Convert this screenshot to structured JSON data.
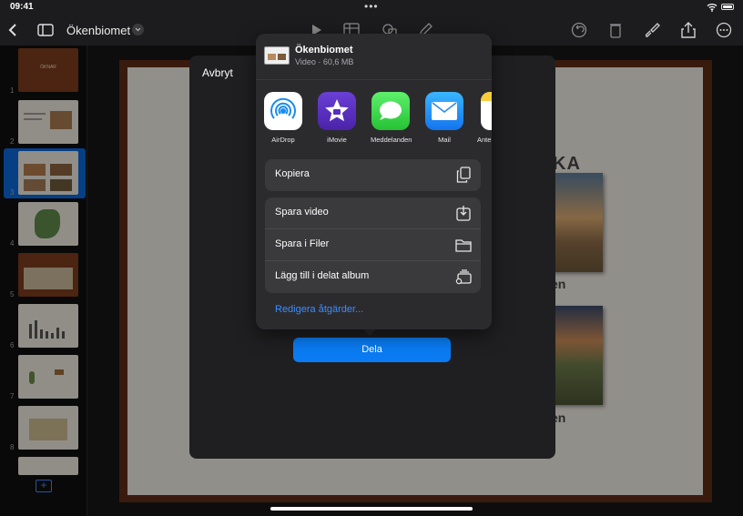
{
  "status_bar": {
    "time": "09:41",
    "dots": "•••"
  },
  "toolbar": {
    "document_title": "Ökenbiomet",
    "icons": [
      "chevron-left-icon",
      "sidebar-icon",
      "play-icon",
      "table-icon",
      "shapes-icon",
      "pencil-icon",
      "undo-icon",
      "trash-icon",
      "brush-icon",
      "share-icon",
      "more-icon"
    ]
  },
  "sidebar": {
    "slides": [
      {
        "number": "1",
        "thumb_text": "ÖKNAR"
      },
      {
        "number": "2",
        "thumb_text": ""
      },
      {
        "number": "3",
        "thumb_text": ""
      },
      {
        "number": "4",
        "thumb_text": ""
      },
      {
        "number": "5",
        "thumb_text": ""
      },
      {
        "number": "6",
        "thumb_text": ""
      },
      {
        "number": "7",
        "thumb_text": ""
      },
      {
        "number": "8",
        "thumb_text": ""
      }
    ],
    "selected_slide": "3",
    "add_label": "+"
  },
  "slide": {
    "title_fragment": "KA",
    "caption_1": "en",
    "caption_2": "en"
  },
  "sheet": {
    "cancel_label": "Avbryt",
    "share_button_label": "Dela"
  },
  "share_popover": {
    "title": "Ökenbiomet",
    "subtitle": "Video · 60,6 MB",
    "apps": [
      {
        "label": "AirDrop",
        "icon": "airdrop-icon"
      },
      {
        "label": "iMovie",
        "icon": "imovie-icon"
      },
      {
        "label": "Meddelanden",
        "icon": "messages-icon"
      },
      {
        "label": "Mail",
        "icon": "mail-icon"
      },
      {
        "label": "Ante",
        "icon": "notes-icon"
      }
    ],
    "actions_group1": [
      {
        "label": "Kopiera",
        "icon": "copy-icon"
      }
    ],
    "actions_group2": [
      {
        "label": "Spara video",
        "icon": "save-download-icon"
      },
      {
        "label": "Spara i Filer",
        "icon": "folder-icon"
      },
      {
        "label": "Lägg till i delat album",
        "icon": "shared-album-icon"
      }
    ],
    "edit_actions_label": "Redigera åtgärder..."
  },
  "colors": {
    "accent": "#0a7bf2",
    "link": "#3a8dff",
    "popover_bg": "#2b2b2e",
    "sheet_bg": "#1f1f21",
    "slide_border": "#5c2d17"
  }
}
